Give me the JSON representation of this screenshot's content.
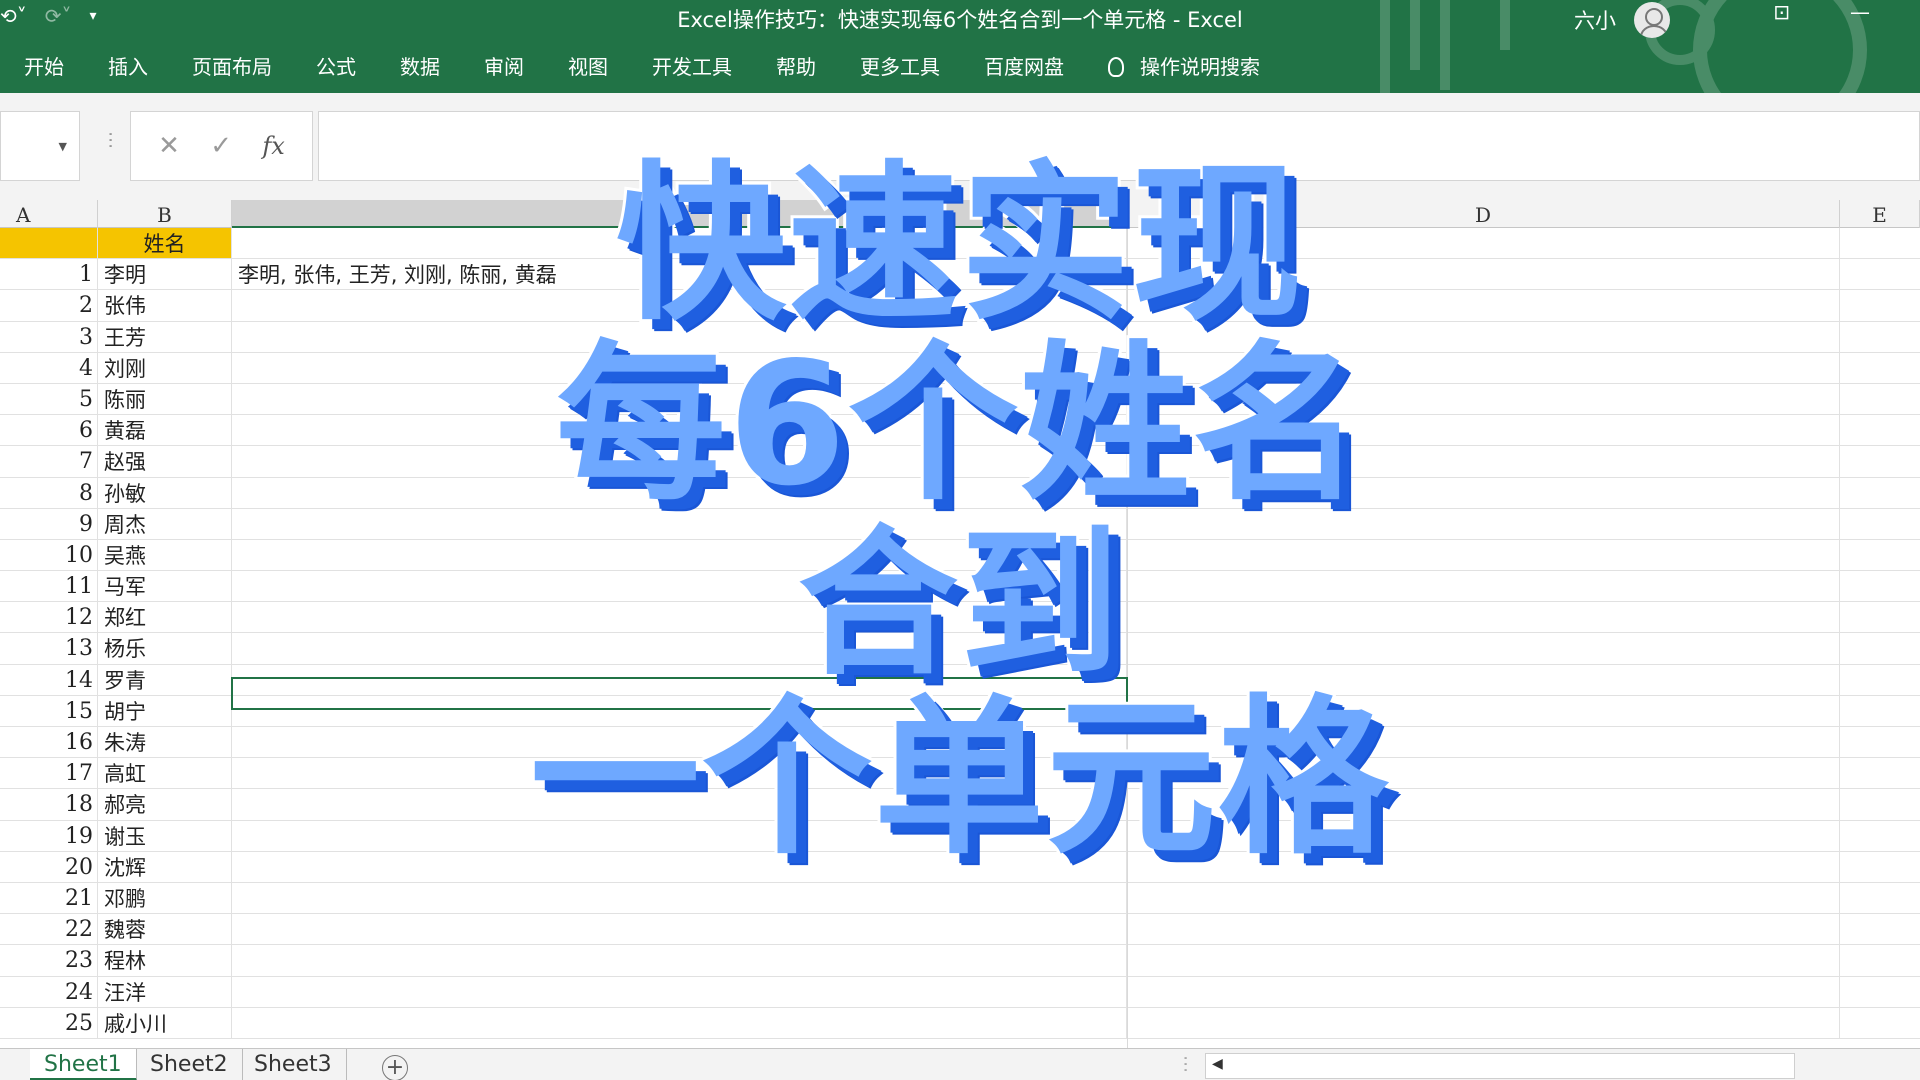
{
  "window": {
    "title": "Excel操作技巧：快速实现每6个姓名合到一个单元格 - Excel",
    "user": "六小"
  },
  "ribbon": {
    "tabs": [
      "开始",
      "插入",
      "页面布局",
      "公式",
      "数据",
      "审阅",
      "视图",
      "开发工具",
      "帮助",
      "更多工具",
      "百度网盘"
    ],
    "search": "操作说明搜索"
  },
  "formula_bar": {
    "name_box": "",
    "fx": "fx",
    "formula": ""
  },
  "columns": [
    "A",
    "B",
    "C",
    "D",
    "E"
  ],
  "sheet": {
    "header_cell": "姓名",
    "rows": [
      {
        "n": "1",
        "name": "李明",
        "result": "李明, 张伟, 王芳, 刘刚, 陈丽, 黄磊"
      },
      {
        "n": "2",
        "name": "张伟",
        "result": ""
      },
      {
        "n": "3",
        "name": "王芳",
        "result": ""
      },
      {
        "n": "4",
        "name": "刘刚",
        "result": ""
      },
      {
        "n": "5",
        "name": "陈丽",
        "result": ""
      },
      {
        "n": "6",
        "name": "黄磊",
        "result": ""
      },
      {
        "n": "7",
        "name": "赵强",
        "result": ""
      },
      {
        "n": "8",
        "name": "孙敏",
        "result": ""
      },
      {
        "n": "9",
        "name": "周杰",
        "result": ""
      },
      {
        "n": "10",
        "name": "吴燕",
        "result": ""
      },
      {
        "n": "11",
        "name": "马军",
        "result": ""
      },
      {
        "n": "12",
        "name": "郑红",
        "result": ""
      },
      {
        "n": "13",
        "name": "杨乐",
        "result": ""
      },
      {
        "n": "14",
        "name": "罗青",
        "result": ""
      },
      {
        "n": "15",
        "name": "胡宁",
        "result": ""
      },
      {
        "n": "16",
        "name": "朱涛",
        "result": ""
      },
      {
        "n": "17",
        "name": "高虹",
        "result": ""
      },
      {
        "n": "18",
        "name": "郝亮",
        "result": ""
      },
      {
        "n": "19",
        "name": "谢玉",
        "result": ""
      },
      {
        "n": "20",
        "name": "沈辉",
        "result": ""
      },
      {
        "n": "21",
        "name": "邓鹏",
        "result": ""
      },
      {
        "n": "22",
        "name": "魏蓉",
        "result": ""
      },
      {
        "n": "23",
        "name": "程林",
        "result": ""
      },
      {
        "n": "24",
        "name": "汪洋",
        "result": ""
      },
      {
        "n": "25",
        "name": "戚小川",
        "result": ""
      }
    ]
  },
  "sheet_tabs": [
    "Sheet1",
    "Sheet2",
    "Sheet3"
  ],
  "overlay": {
    "line1": "快速实现",
    "line2": "每6个姓名",
    "line3": "合到",
    "line4": "一个单元格"
  },
  "colors": {
    "excel_green": "#217346",
    "header_fill": "#f5c400",
    "overlay_fill": "#6ea8ff",
    "overlay_shadow": "#1f5fe0"
  }
}
